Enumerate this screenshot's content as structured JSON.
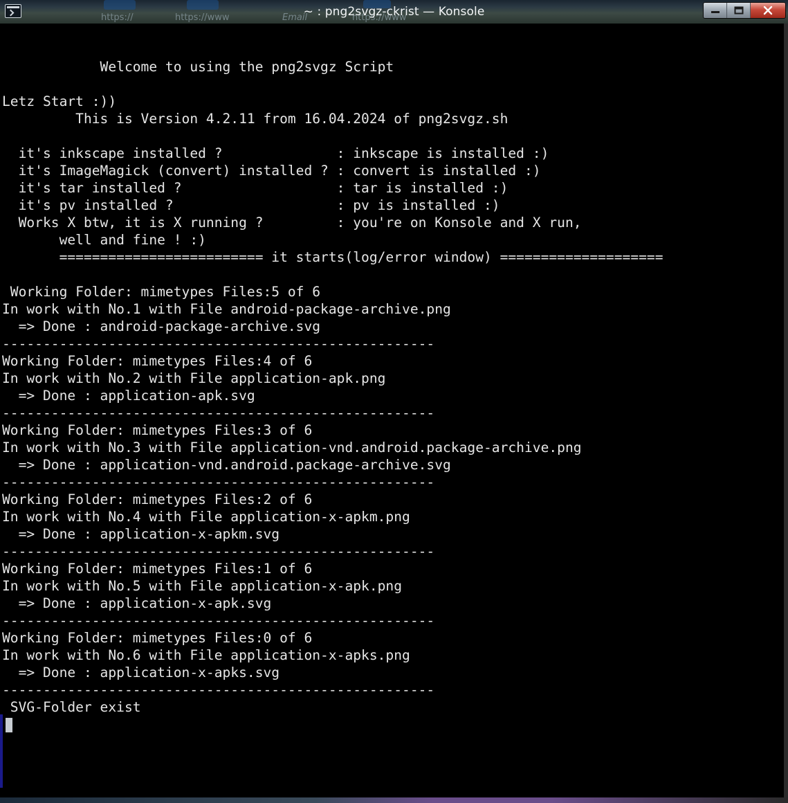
{
  "window": {
    "title": "~ : png2svgz-ckrist — Konsole",
    "background_ghost_texts": [
      "https://",
      "https://www",
      "Email",
      "https://www"
    ]
  },
  "terminal": {
    "lines": [
      "            Welcome to using the png2svgz Script",
      "",
      "Letz Start :))",
      "         This is Version 4.2.11 from 16.04.2024 of png2svgz.sh",
      "",
      "  it's inkscape installed ?              : inkscape is installed :)",
      "  it's ImageMagick (convert) installed ? : convert is installed :)",
      "  it's tar installed ?                   : tar is installed :)",
      "  it's pv installed ?                    : pv is installed :)",
      "  Works X btw, it is X running ?         : you're on Konsole and X run,",
      "       well and fine ! :)",
      "       ========================= it starts(log/error window) ====================",
      "",
      " Working Folder: mimetypes Files:5 of 6",
      "In work with No.1 with File android-package-archive.png",
      "  => Done : android-package-archive.svg",
      "-----------------------------------------------------",
      "Working Folder: mimetypes Files:4 of 6",
      "In work with No.2 with File application-apk.png",
      "  => Done : application-apk.svg",
      "-----------------------------------------------------",
      "Working Folder: mimetypes Files:3 of 6",
      "In work with No.3 with File application-vnd.android.package-archive.png",
      "  => Done : application-vnd.android.package-archive.svg",
      "-----------------------------------------------------",
      "Working Folder: mimetypes Files:2 of 6",
      "In work with No.4 with File application-x-apkm.png",
      "  => Done : application-x-apkm.svg",
      "-----------------------------------------------------",
      "Working Folder: mimetypes Files:1 of 6",
      "In work with No.5 with File application-x-apk.png",
      "  => Done : application-x-apk.svg",
      "-----------------------------------------------------",
      "Working Folder: mimetypes Files:0 of 6",
      "In work with No.6 with File application-x-apks.png",
      "  => Done : application-x-apks.svg",
      "-----------------------------------------------------",
      " SVG-Folder exist"
    ]
  },
  "colors": {
    "terminal_bg": "#000000",
    "terminal_fg": "#e6e6e6",
    "cursor": "#c8cdd3",
    "close_button": "#c7493a"
  },
  "icons": {
    "app": "konsole-terminal-icon",
    "minimize": "minimize-icon",
    "maximize": "maximize-icon",
    "close": "close-icon"
  }
}
